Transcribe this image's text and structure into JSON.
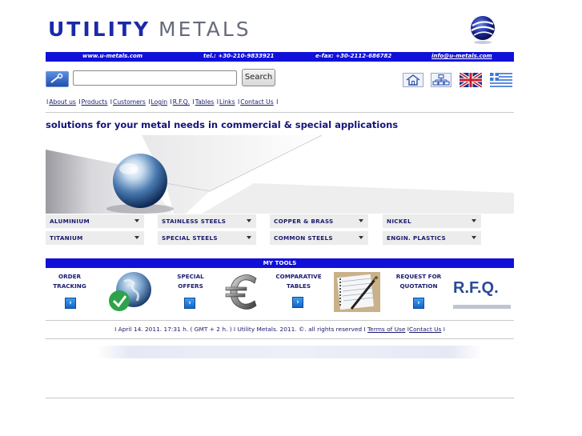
{
  "header": {
    "logo_part1": "UTILITY",
    "logo_part2": "METALS",
    "brand_color": "#1a2aa8"
  },
  "infobar": {
    "website": "www.u-metals.com",
    "tel": "tel.: +30-210-9833921",
    "fax": "e-fax: +30-2112-686782",
    "email": "info@u-metals.com"
  },
  "search": {
    "value": "",
    "button_label": "Search"
  },
  "tools_icons": [
    "home-icon",
    "sitemap-icon",
    "uk-flag-icon",
    "greek-flag-icon"
  ],
  "nav": {
    "items": [
      "About us",
      "Products",
      "Customers",
      "Login",
      "R.F.Q.",
      "Tables",
      "Links",
      "Contact Us"
    ]
  },
  "tagline": "solutions for your metal needs in commercial & special applications",
  "categories": {
    "row1": [
      "ALUMINIUM",
      "STAINLESS STEELS",
      "COPPER & BRASS",
      "NICKEL"
    ],
    "row2": [
      "TITANIUM",
      "SPECIAL STEELS",
      "COMMON STEELS",
      "ENGIN. PLASTICS"
    ]
  },
  "my_tools": {
    "title": "MY TOOLS",
    "tools": [
      {
        "line1": "ORDER",
        "line2": "TRACKING"
      },
      {
        "line1": "SPECIAL",
        "line2": "OFFERS"
      },
      {
        "line1": "COMPARATIVE",
        "line2": "TABLES"
      },
      {
        "line1": "REQUEST FOR",
        "line2": "QUOTATION"
      }
    ],
    "rfq_badge": "R.F.Q."
  },
  "footer": {
    "text": "I April 14. 2011. 17:31 h. ( GMT + 2 h. ) I Utility Metals. 2011. ©. all rights reserved I",
    "terms": "Terms of Use",
    "contact": "Contact Us"
  }
}
